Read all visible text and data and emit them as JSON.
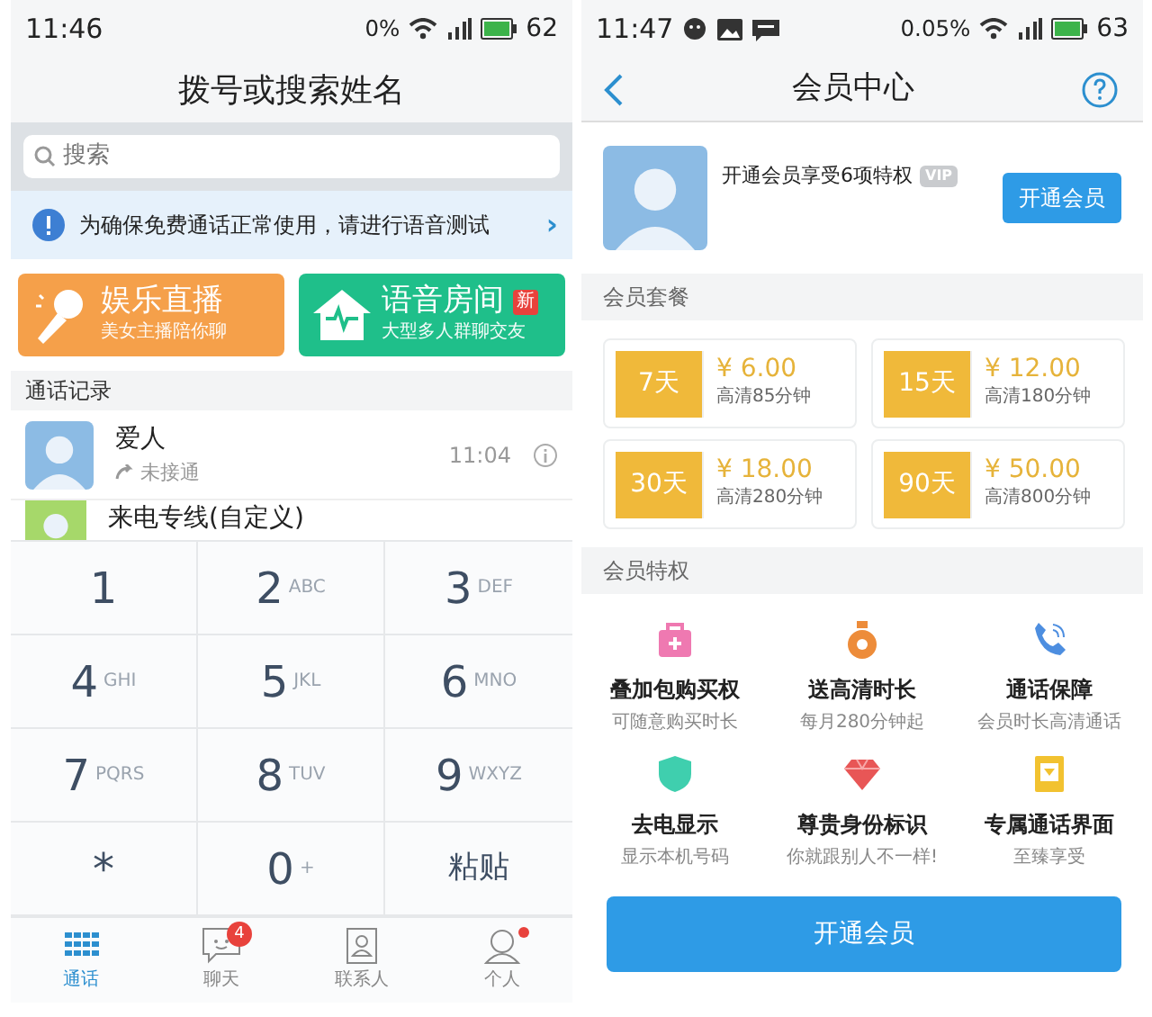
{
  "left": {
    "status_bar": {
      "time": "11:46",
      "data_rate": "0%",
      "battery": "62"
    },
    "title": "拨号或搜索姓名",
    "search": {
      "placeholder": "搜索"
    },
    "notice": {
      "text": "为确保免费通话正常使用，请进行语音测试",
      "chevron": "›"
    },
    "promos": [
      {
        "kind": "mic",
        "title": "娱乐直播",
        "subtitle": "美女主播陪你聊",
        "color": "#f5a04a"
      },
      {
        "kind": "house",
        "title": "语音房间",
        "badge": "新",
        "subtitle": "大型多人群聊交友",
        "color": "#1fbf8a"
      }
    ],
    "section": "通话记录",
    "calls": [
      {
        "name": "爱人",
        "status": "未接通",
        "time": "11:04"
      },
      {
        "name": "来电专线(自定义)",
        "partial": true
      }
    ],
    "dialpad": [
      {
        "key": "1"
      },
      {
        "key": "2",
        "letters": "ABC"
      },
      {
        "key": "3",
        "letters": "DEF"
      },
      {
        "key": "4",
        "letters": "GHI"
      },
      {
        "key": "5",
        "letters": "JKL"
      },
      {
        "key": "6",
        "letters": "MNO"
      },
      {
        "key": "7",
        "letters": "PQRS"
      },
      {
        "key": "8",
        "letters": "TUV"
      },
      {
        "key": "9",
        "letters": "WXYZ"
      },
      {
        "key": "*"
      },
      {
        "key": "0",
        "letters": "+"
      },
      {
        "key": "粘贴"
      }
    ],
    "tabs": [
      {
        "kind": "dialpad",
        "label": "通话",
        "selected": true
      },
      {
        "kind": "chat",
        "label": "聊天",
        "selected": false,
        "badge": "4"
      },
      {
        "kind": "contacts",
        "label": "联系人",
        "selected": false
      },
      {
        "kind": "person",
        "label": "个人",
        "selected": false,
        "dot": true
      }
    ]
  },
  "right": {
    "status_bar": {
      "time": "11:47",
      "data_rate": "0.05%",
      "battery": "63"
    },
    "title": "会员中心",
    "profile": {
      "text": "开通会员享受6项特权",
      "tag": "VIP",
      "button": "开通会员"
    },
    "plans_section": "会员套餐",
    "plans": [
      {
        "days": "7天",
        "price": "¥ 6.00",
        "minutes": "高清85分钟"
      },
      {
        "days": "15天",
        "price": "¥ 12.00",
        "minutes": "高清180分钟"
      },
      {
        "days": "30天",
        "price": "¥ 18.00",
        "minutes": "高清280分钟"
      },
      {
        "days": "90天",
        "price": "¥ 50.00",
        "minutes": "高清800分钟"
      }
    ],
    "perks_section": "会员特权",
    "perks": [
      {
        "kind": "bag",
        "title": "叠加包购买权",
        "subtitle": "可随意购买时长"
      },
      {
        "kind": "moneybag",
        "title": "送高清时长",
        "subtitle": "每月280分钟起"
      },
      {
        "kind": "phone",
        "title": "通话保障",
        "subtitle": "会员时长高清通话"
      },
      {
        "kind": "shield",
        "title": "去电显示",
        "subtitle": "显示本机号码"
      },
      {
        "kind": "gem",
        "title": "尊贵身份标识",
        "subtitle": "你就跟别人不一样!"
      },
      {
        "kind": "card",
        "title": "专属通话界面",
        "subtitle": "至臻享受"
      }
    ],
    "button": "开通会员"
  }
}
